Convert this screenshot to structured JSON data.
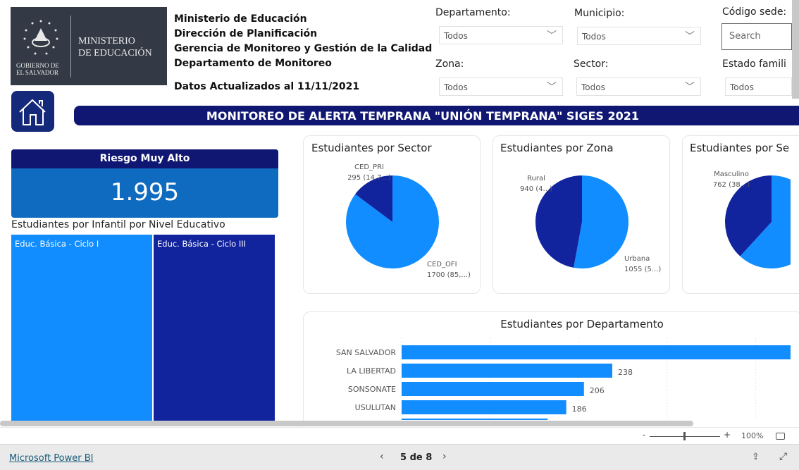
{
  "logo": {
    "line1": "MINISTERIO",
    "line2": "DE EDUCACIÓN",
    "gov1": "GOBIERNO DE",
    "gov2": "EL SALVADOR"
  },
  "header": {
    "lines": [
      "Ministerio de Educación",
      "Dirección de Planificación",
      "Gerencia de Monitoreo y Gestión de la Calidad",
      "Departamento de Monitoreo"
    ],
    "updated": "Datos Actualizados al 11/11/2021"
  },
  "filters": {
    "departamento": {
      "label": "Departamento:",
      "value": "Todos"
    },
    "municipio": {
      "label": "Municipio:",
      "value": "Todos"
    },
    "codigo": {
      "label": "Código sede:",
      "placeholder": "Search"
    },
    "zona": {
      "label": "Zona:",
      "value": "Todos"
    },
    "sector": {
      "label": "Sector:",
      "value": "Todos"
    },
    "estado": {
      "label": "Estado famili",
      "value": "Todos"
    }
  },
  "banner": "MONITOREO DE ALERTA TEMPRANA \"UNIÓN TEMPRANA\" SIGES 2021",
  "kpi": {
    "title": "Riesgo Muy Alto",
    "value": "1.995"
  },
  "treemap": {
    "title": "Estudiantes por Infantil por Nivel Educativo",
    "items": [
      "Educ. Básica - Ciclo I",
      "Educ. Básica - Ciclo III"
    ]
  },
  "colors": {
    "light": "#118dff",
    "dark": "#12239e",
    "navy": "#0f1772"
  },
  "chart_data": [
    {
      "type": "pie",
      "title": "Estudiantes por Sector",
      "slices": [
        {
          "name": "CED_OFI",
          "value": 1700,
          "label1": "CED_OFI",
          "label2": "1700 (85,...)"
        },
        {
          "name": "CED_PRI",
          "value": 295,
          "label1": "CED_PRI",
          "label2": "295 (14,7...)"
        }
      ]
    },
    {
      "type": "pie",
      "title": "Estudiantes por Zona",
      "slices": [
        {
          "name": "Urbana",
          "value": 1055,
          "label1": "Urbana",
          "label2": "1055 (5...)"
        },
        {
          "name": "Rural",
          "value": 940,
          "label1": "Rural",
          "label2": "940 (4...)"
        }
      ]
    },
    {
      "type": "pie",
      "title": "Estudiantes por Se",
      "slices": [
        {
          "value": 1233
        },
        {
          "name": "Masculino",
          "value": 762,
          "label1": "Masculino",
          "label2": "762 (38...)"
        }
      ]
    },
    {
      "type": "bar",
      "title": "Estudiantes por Departamento",
      "categories": [
        "SAN SALVADOR",
        "LA LIBERTAD",
        "SONSONATE",
        "USULUTAN",
        ""
      ],
      "values": [
        null,
        238,
        206,
        186,
        165
      ],
      "xlim": [
        0,
        440
      ],
      "grid": true
    }
  ],
  "zoom": {
    "minus": "-",
    "plus": "+",
    "level": "100%",
    "slider_percent": 0.5
  },
  "footer": {
    "brand": "Microsoft Power BI",
    "page": "5 de 8"
  }
}
